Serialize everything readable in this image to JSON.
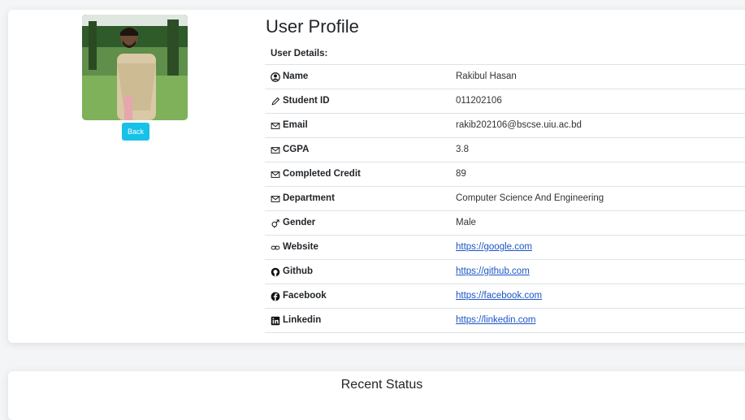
{
  "profile": {
    "title": "User Profile",
    "details_header": "User Details:",
    "back_label": "Back",
    "rows": [
      {
        "label": "Name",
        "value": "Rakibul Hasan",
        "icon": "user-circle-icon",
        "link": false
      },
      {
        "label": "Student ID",
        "value": "011202106",
        "icon": "pencil-icon",
        "link": false
      },
      {
        "label": "Email",
        "value": "rakib202106@bscse.uiu.ac.bd",
        "icon": "envelope-icon",
        "link": false
      },
      {
        "label": "CGPA",
        "value": "3.8",
        "icon": "envelope-icon",
        "link": false
      },
      {
        "label": "Completed Credit",
        "value": "89",
        "icon": "envelope-icon",
        "link": false
      },
      {
        "label": "Department",
        "value": "Computer Science And Engineering",
        "icon": "envelope-icon",
        "link": false
      },
      {
        "label": "Gender",
        "value": "Male",
        "icon": "gender-icon",
        "link": false
      },
      {
        "label": "Website",
        "value": "https://google.com",
        "icon": "link-icon",
        "link": true
      },
      {
        "label": "Github",
        "value": "https://github.com",
        "icon": "github-icon",
        "link": true
      },
      {
        "label": "Facebook",
        "value": "https://facebook.com",
        "icon": "facebook-icon",
        "link": true
      },
      {
        "label": "Linkedin",
        "value": "https://linkedin.com",
        "icon": "linkedin-icon",
        "link": true
      }
    ]
  },
  "status": {
    "title": "Recent Status"
  },
  "colors": {
    "accent": "#17c1e8",
    "link": "#1a55c4"
  }
}
